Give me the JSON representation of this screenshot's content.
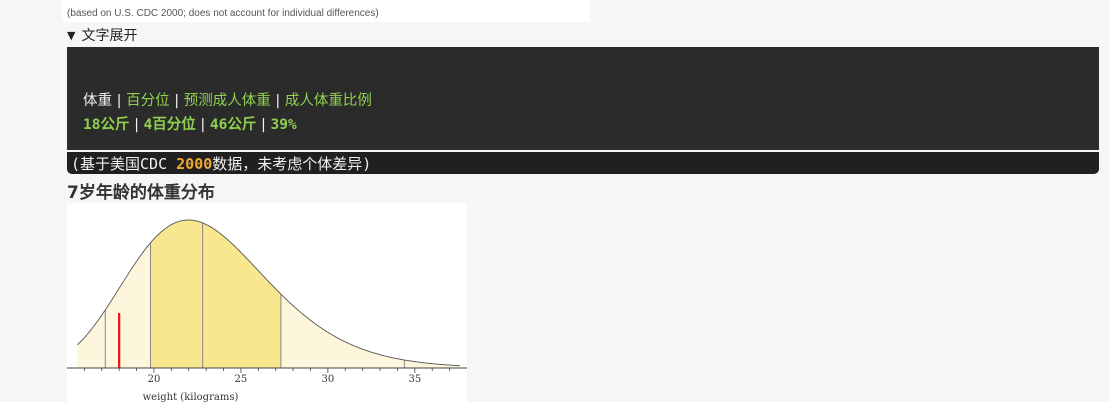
{
  "top_note": "(based on U.S. CDC 2000; does not account for individual differences)",
  "toggle": {
    "icon": "triangle-down-icon",
    "arrow": "▼",
    "label": "文字展开"
  },
  "table": {
    "headers": [
      "体重",
      "百分位",
      "预测成人体重",
      "成人体重比例"
    ],
    "values": [
      "18公斤",
      "4百分位",
      "46公斤",
      "39%"
    ],
    "separator": "|"
  },
  "note": {
    "prefix": "(基于美国CDC ",
    "year": "2000",
    "suffix": "数据，未考虑个体差异)"
  },
  "chart_title": "7岁年龄的体重分布",
  "chart_data": {
    "type": "area",
    "xlabel": "weight (kilograms)",
    "xlim": [
      15,
      38
    ],
    "xticks": [
      20,
      25,
      30,
      35
    ],
    "distribution": "right-skewed weight distribution",
    "band_boundaries_kg": [
      17.2,
      19.8,
      22.8,
      27.3,
      34.4
    ],
    "shading": {
      "outer": "#fdf6dc",
      "inner": "#f9e78f"
    },
    "marker": {
      "value": 18,
      "color": "#e8140c"
    },
    "colors": {
      "curve": "#555555",
      "axis": "#444444"
    }
  }
}
